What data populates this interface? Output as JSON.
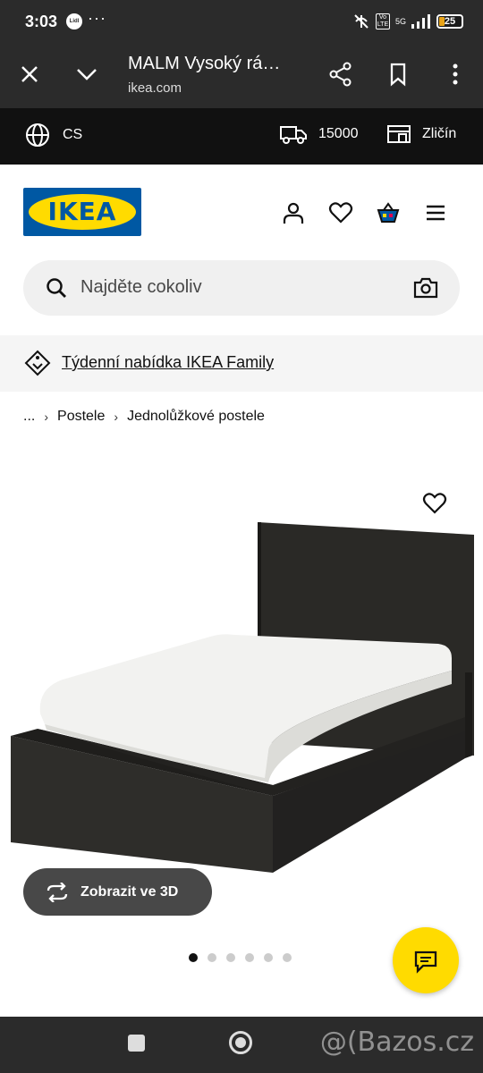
{
  "status_bar": {
    "time": "3:03",
    "more": "···",
    "app_icon_label": "Lidl",
    "network": "5G",
    "volte": "Vo LTE",
    "battery": "25",
    "battery_percent": 25
  },
  "browser": {
    "title": "MALM Vysoký rá…",
    "url": "ikea.com",
    "icons": [
      "close-icon",
      "chevron-down-icon",
      "share-icon",
      "bookmark-icon",
      "more-vert-icon"
    ]
  },
  "utility": {
    "language": "CS",
    "delivery": "15000",
    "store": "Zličín"
  },
  "header": {
    "logo_text": "IKEA",
    "icons": [
      "user-icon",
      "heart-icon",
      "basket-icon",
      "hamburger-icon"
    ]
  },
  "search": {
    "placeholder": "Najděte cokoliv"
  },
  "family_banner": {
    "label": "Týdenní nabídka IKEA Family"
  },
  "breadcrumb": {
    "ellipsis": "...",
    "items": [
      "Postele",
      "Jednolůžkové postele"
    ]
  },
  "product": {
    "view_3d_label": "Zobrazit ve 3D",
    "image_count": 6,
    "active_image": 1
  },
  "watermark": "@(Bazos.cz",
  "colors": {
    "ikea_blue": "#0058a3",
    "ikea_yellow": "#ffdb00",
    "dark": "#111111",
    "button_grey": "#484848"
  }
}
